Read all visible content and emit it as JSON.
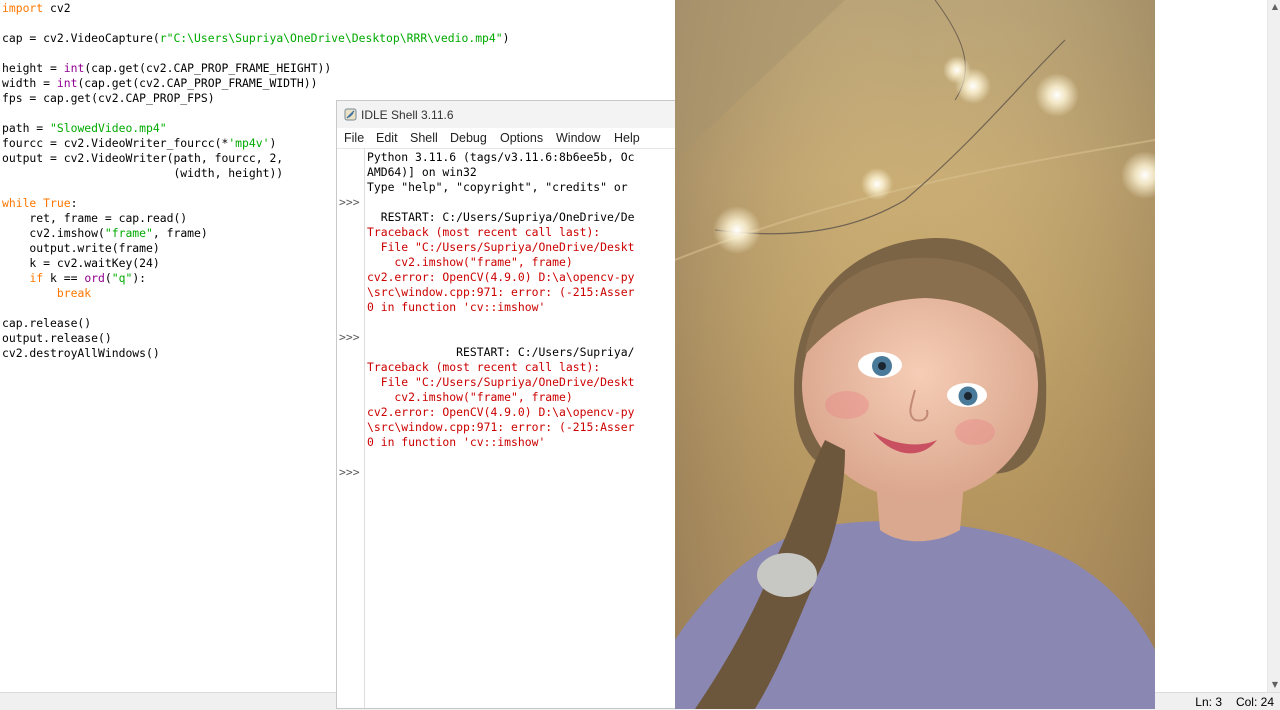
{
  "editor": {
    "code_lines": [
      {
        "segs": [
          {
            "t": "import",
            "c": "kw"
          },
          {
            "t": " cv2",
            "c": ""
          }
        ]
      },
      {
        "segs": []
      },
      {
        "segs": [
          {
            "t": "cap = cv2.VideoCapture(",
            "c": ""
          },
          {
            "t": "r\"C:\\Users\\Supriya\\OneDrive\\Desktop\\RRR\\vedio.mp4\"",
            "c": "st"
          },
          {
            "t": ")",
            "c": ""
          }
        ]
      },
      {
        "segs": []
      },
      {
        "segs": [
          {
            "t": "height = ",
            "c": ""
          },
          {
            "t": "int",
            "c": "bi"
          },
          {
            "t": "(cap.get(cv2.CAP_PROP_FRAME_HEIGHT))",
            "c": ""
          }
        ]
      },
      {
        "segs": [
          {
            "t": "width = ",
            "c": ""
          },
          {
            "t": "int",
            "c": "bi"
          },
          {
            "t": "(cap.get(cv2.CAP_PROP_FRAME_WIDTH))",
            "c": ""
          }
        ]
      },
      {
        "segs": [
          {
            "t": "fps = cap.get(cv2.CAP_PROP_FPS)",
            "c": ""
          }
        ]
      },
      {
        "segs": []
      },
      {
        "segs": [
          {
            "t": "path = ",
            "c": ""
          },
          {
            "t": "\"SlowedVideo.mp4\"",
            "c": "st"
          }
        ]
      },
      {
        "segs": [
          {
            "t": "fourcc = cv2.VideoWriter_fourcc(*",
            "c": ""
          },
          {
            "t": "'mp4v'",
            "c": "st"
          },
          {
            "t": ")",
            "c": ""
          }
        ]
      },
      {
        "segs": [
          {
            "t": "output = cv2.VideoWriter(path, fourcc, 2,",
            "c": ""
          }
        ]
      },
      {
        "segs": [
          {
            "t": "                         (width, height))",
            "c": ""
          }
        ]
      },
      {
        "segs": []
      },
      {
        "segs": [
          {
            "t": "while",
            "c": "kw"
          },
          {
            "t": " ",
            "c": ""
          },
          {
            "t": "True",
            "c": "kw"
          },
          {
            "t": ":",
            "c": ""
          }
        ]
      },
      {
        "segs": [
          {
            "t": "    ret, frame = cap.read()",
            "c": ""
          }
        ]
      },
      {
        "segs": [
          {
            "t": "    cv2.imshow(",
            "c": ""
          },
          {
            "t": "\"frame\"",
            "c": "st"
          },
          {
            "t": ", frame)",
            "c": ""
          }
        ]
      },
      {
        "segs": [
          {
            "t": "    output.write(frame)",
            "c": ""
          }
        ]
      },
      {
        "segs": [
          {
            "t": "    k = cv2.waitKey(24)",
            "c": ""
          }
        ]
      },
      {
        "segs": [
          {
            "t": "    ",
            "c": ""
          },
          {
            "t": "if",
            "c": "kw"
          },
          {
            "t": " k == ",
            "c": ""
          },
          {
            "t": "ord",
            "c": "bi"
          },
          {
            "t": "(",
            "c": ""
          },
          {
            "t": "\"q\"",
            "c": "st"
          },
          {
            "t": "):",
            "c": ""
          }
        ]
      },
      {
        "segs": [
          {
            "t": "        ",
            "c": ""
          },
          {
            "t": "break",
            "c": "kw"
          }
        ]
      },
      {
        "segs": []
      },
      {
        "segs": [
          {
            "t": "cap.release()",
            "c": ""
          }
        ]
      },
      {
        "segs": [
          {
            "t": "output.release()",
            "c": ""
          }
        ]
      },
      {
        "segs": [
          {
            "t": "cv2.destroyAllWindows()",
            "c": ""
          }
        ]
      }
    ]
  },
  "statusbar": {
    "ln": "Ln: 3",
    "col": "Col: 24"
  },
  "shell": {
    "title": "IDLE Shell 3.11.6",
    "menu": [
      "File",
      "Edit",
      "Shell",
      "Debug",
      "Options",
      "Window",
      "Help"
    ],
    "prompt": ">>>",
    "prompt_lines": [
      3,
      12,
      21
    ],
    "lines": [
      {
        "t": "Python 3.11.6 (tags/v3.11.6:8b6ee5b, Oc",
        "c": "plain"
      },
      {
        "t": "AMD64)] on win32",
        "c": "plain"
      },
      {
        "t": "Type \"help\", \"copyright\", \"credits\" or",
        "c": "plain"
      },
      {
        "t": "",
        "c": "plain"
      },
      {
        "t": "  RESTART: C:/Users/Supriya/OneDrive/De",
        "c": "plain"
      },
      {
        "t": "Traceback (most recent call last):",
        "c": "err"
      },
      {
        "t": "  File \"C:/Users/Supriya/OneDrive/Deskt",
        "c": "err"
      },
      {
        "t": "    cv2.imshow(\"frame\", frame)",
        "c": "err"
      },
      {
        "t": "cv2.error: OpenCV(4.9.0) D:\\a\\opencv-py",
        "c": "err"
      },
      {
        "t": "\\src\\window.cpp:971: error: (-215:Asser",
        "c": "err"
      },
      {
        "t": "0 in function 'cv::imshow'",
        "c": "err"
      },
      {
        "t": "",
        "c": "plain"
      },
      {
        "t": "",
        "c": "plain"
      },
      {
        "t": "             RESTART: C:/Users/Supriya/",
        "c": "plain"
      },
      {
        "t": "Traceback (most recent call last):",
        "c": "err"
      },
      {
        "t": "  File \"C:/Users/Supriya/OneDrive/Deskt",
        "c": "err"
      },
      {
        "t": "    cv2.imshow(\"frame\", frame)",
        "c": "err"
      },
      {
        "t": "cv2.error: OpenCV(4.9.0) D:\\a\\opencv-py",
        "c": "err"
      },
      {
        "t": "\\src\\window.cpp:971: error: (-215:Asser",
        "c": "err"
      },
      {
        "t": "0 in function 'cv::imshow'",
        "c": "err"
      }
    ]
  },
  "frame_window": {
    "content": "video frame of a smiling young girl",
    "icon": "idle-feather-icon"
  }
}
